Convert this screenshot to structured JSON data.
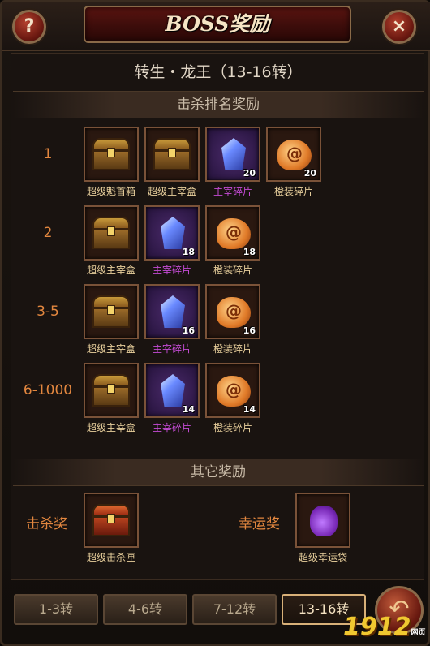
{
  "header": {
    "title": "BOSS奖励",
    "help_label": "?",
    "close_label": "×"
  },
  "boss": {
    "name": "转生・龙王（13-16转）"
  },
  "kill_rank": {
    "title": "击杀排名奖励",
    "ranks": [
      {
        "label": "1",
        "items": [
          {
            "name": "超级魁首箱",
            "icon": "treasure-chest-icon",
            "count": ""
          },
          {
            "name": "超级主宰盒",
            "icon": "treasure-chest-icon",
            "count": ""
          },
          {
            "name": "主宰碎片",
            "icon": "blue-gem-shard-icon",
            "count": "20"
          },
          {
            "name": "橙装碎片",
            "icon": "orange-shard-icon",
            "count": "20"
          }
        ]
      },
      {
        "label": "2",
        "items": [
          {
            "name": "超级主宰盒",
            "icon": "treasure-chest-icon",
            "count": ""
          },
          {
            "name": "主宰碎片",
            "icon": "blue-gem-shard-icon",
            "count": "18"
          },
          {
            "name": "橙装碎片",
            "icon": "orange-shard-icon",
            "count": "18"
          }
        ]
      },
      {
        "label": "3-5",
        "items": [
          {
            "name": "超级主宰盒",
            "icon": "treasure-chest-icon",
            "count": ""
          },
          {
            "name": "主宰碎片",
            "icon": "blue-gem-shard-icon",
            "count": "16"
          },
          {
            "name": "橙装碎片",
            "icon": "orange-shard-icon",
            "count": "16"
          }
        ]
      },
      {
        "label": "6-1000",
        "items": [
          {
            "name": "超级主宰盒",
            "icon": "treasure-chest-icon",
            "count": ""
          },
          {
            "name": "主宰碎片",
            "icon": "blue-gem-shard-icon",
            "count": "14"
          },
          {
            "name": "橙装碎片",
            "icon": "orange-shard-icon",
            "count": "14"
          }
        ]
      }
    ]
  },
  "other": {
    "title": "其它奖励",
    "kill_label": "击杀奖",
    "kill_item": {
      "name": "超级击杀匣",
      "icon": "red-chest-icon"
    },
    "luck_label": "幸运奖",
    "luck_item": {
      "name": "超级幸运袋",
      "icon": "purple-bag-icon"
    }
  },
  "tabs": [
    {
      "label": "1-3转",
      "active": false
    },
    {
      "label": "4-6转",
      "active": false
    },
    {
      "label": "7-12转",
      "active": false
    },
    {
      "label": "13-16转",
      "active": true
    }
  ],
  "back_icon": "back-arrow-icon",
  "watermark": {
    "number": "1912",
    "small": "网页游戏"
  },
  "colors": {
    "rank": "#e3873f",
    "item_gold": "#e8cf9c",
    "item_violet": "#c54bd6",
    "accent_border": "#d8b078"
  }
}
